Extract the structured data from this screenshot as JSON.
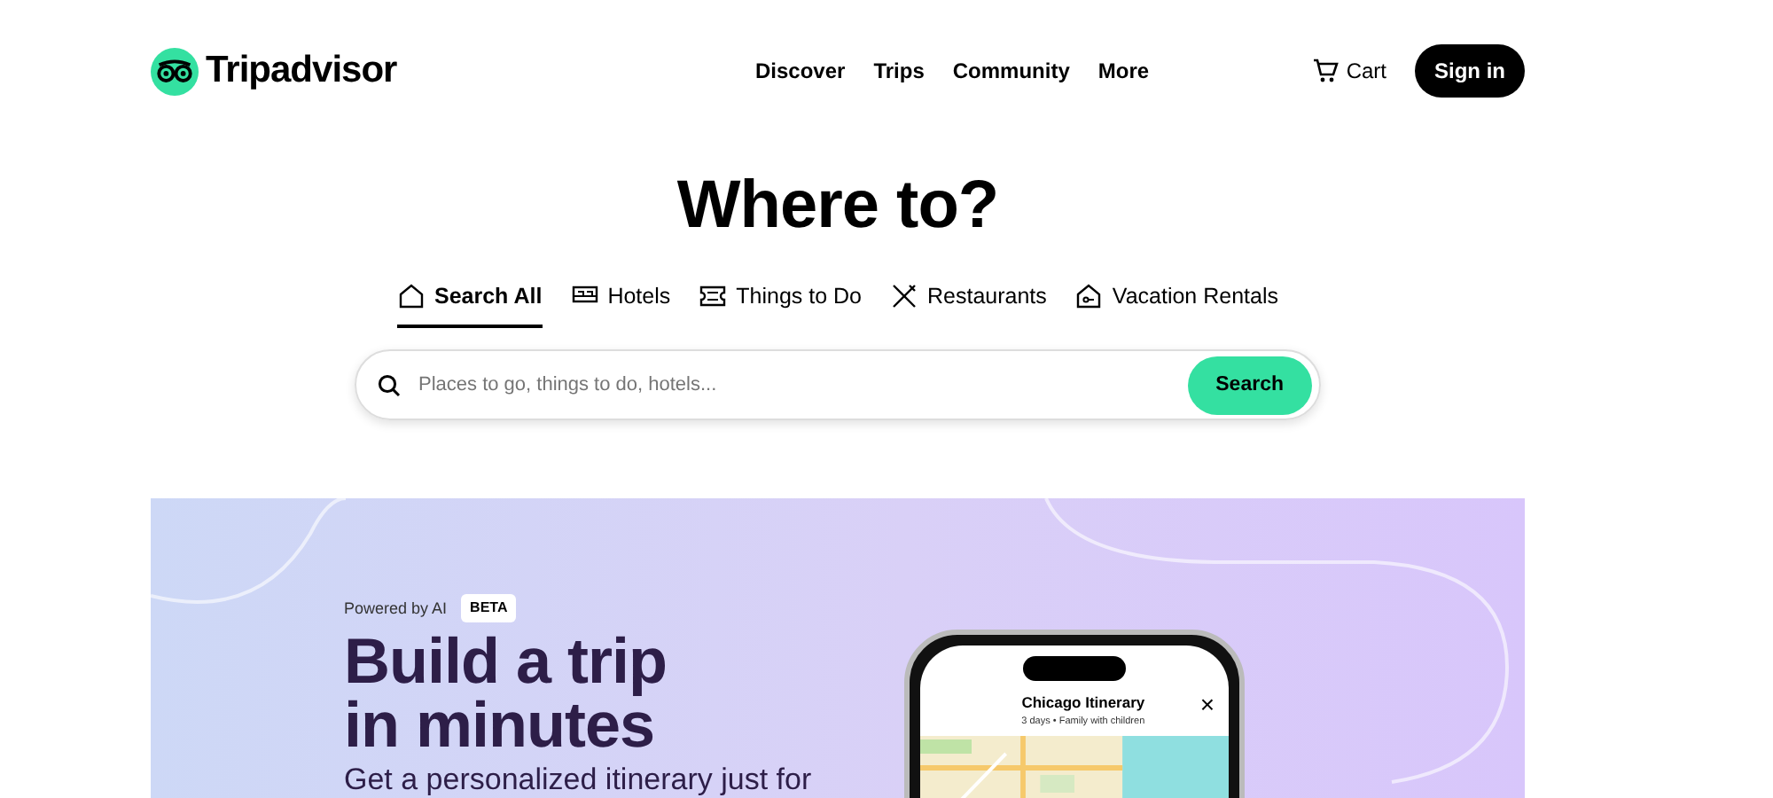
{
  "header": {
    "logo": "Tripadvisor",
    "nav": [
      "Discover",
      "Trips",
      "Community",
      "More"
    ],
    "cart": "Cart",
    "sign_in": "Sign in"
  },
  "hero": {
    "title": "Where to?"
  },
  "tabs": [
    {
      "label": "Search All",
      "kind": "house",
      "selected": true
    },
    {
      "label": "Hotels",
      "kind": "bed",
      "selected": false
    },
    {
      "label": "Things to Do",
      "kind": "ticket",
      "selected": false
    },
    {
      "label": "Restaurants",
      "kind": "utensils",
      "selected": false
    },
    {
      "label": "Vacation Rentals",
      "kind": "rental",
      "selected": false
    }
  ],
  "search": {
    "placeholder": "Places to go, things to do, hotels...",
    "button": "Search"
  },
  "banner": {
    "eyebrow": "Powered by AI",
    "badge": "BETA",
    "headline": [
      "Build a trip",
      "in minutes"
    ],
    "subtitle": "Get a personalized itinerary just for",
    "phone": {
      "title": "Chicago Itinerary",
      "subtitle": "3 days • Family with children",
      "close": "×"
    }
  }
}
